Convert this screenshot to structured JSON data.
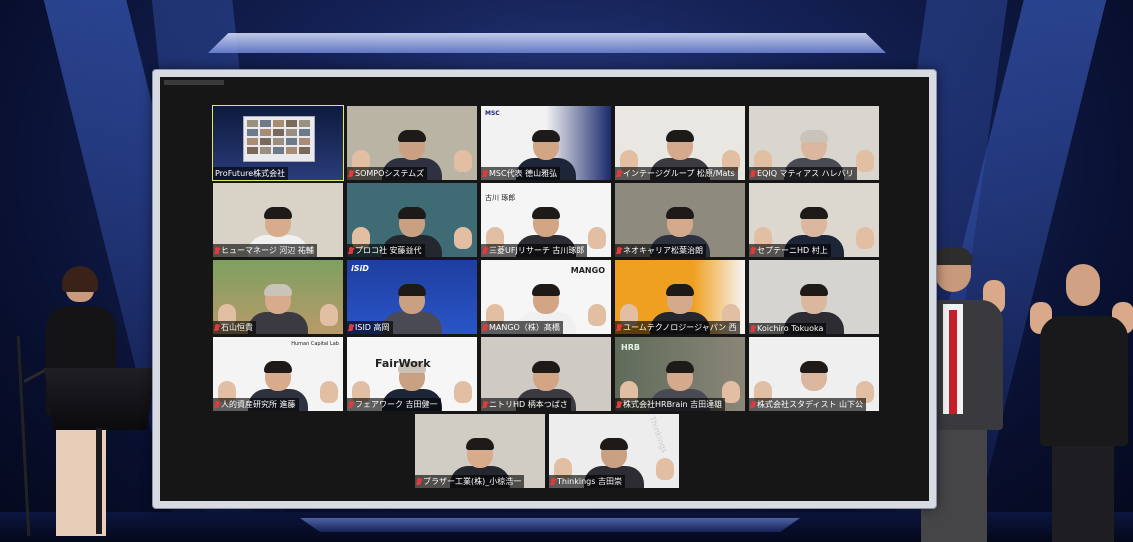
{
  "window": {
    "title": ""
  },
  "colors": {
    "active_speaker_border": "#e4ea52",
    "mic_muted": "#e03a3a",
    "stage_blue": "#152257"
  },
  "tiles": [
    {
      "name": "ProFuture株式会社",
      "muted": false,
      "active": true
    },
    {
      "name": "SOMPOシステムズ",
      "muted": true,
      "active": false
    },
    {
      "name": "MSC代表 德山雅弘",
      "muted": true,
      "active": false
    },
    {
      "name": "インテージグループ 松原/Mats",
      "muted": true,
      "active": false
    },
    {
      "name": "EQIQ マティアス ハレバリ",
      "muted": true,
      "active": false
    },
    {
      "name": "ヒューマネージ 河辺 祐輔",
      "muted": true,
      "active": false
    },
    {
      "name": "プロコ社 安藤益代",
      "muted": true,
      "active": false
    },
    {
      "name": "三菱UFJリサーチ 古川琢郎",
      "muted": true,
      "active": false
    },
    {
      "name": "ネオキャリア松葉治朗",
      "muted": true,
      "active": false
    },
    {
      "name": "セプテーニHD 村上",
      "muted": true,
      "active": false
    },
    {
      "name": "石山恒貴",
      "muted": true,
      "active": false
    },
    {
      "name": "ISID 高岡",
      "muted": true,
      "active": false
    },
    {
      "name": "MANGO（株）髙橋",
      "muted": true,
      "active": false
    },
    {
      "name": "ユームテクノロジージャパン 西",
      "muted": true,
      "active": false
    },
    {
      "name": "Koichiro Tokuoka",
      "muted": true,
      "active": false
    },
    {
      "name": "人的資産研究所 進藤",
      "muted": true,
      "active": false
    },
    {
      "name": "フェアワーク 吉田健一",
      "muted": true,
      "active": false
    },
    {
      "name": "ニトリHD 柄本つばさ",
      "muted": true,
      "active": false
    },
    {
      "name": "株式会社HRBrain 吉田達雄",
      "muted": true,
      "active": false
    },
    {
      "name": "株式会社スタディスト 山下公",
      "muted": true,
      "active": false
    },
    {
      "name": "ブラザー工業(株)_小椋浩一",
      "muted": true,
      "active": false
    },
    {
      "name": "Thinkings 吉田崇",
      "muted": true,
      "active": false
    }
  ],
  "tile_overlays": {
    "msc_logo": "MSC",
    "mitsubishi_name": "古川 琢郎",
    "mango_logo": "MANGO",
    "isid_logo": "iSiD",
    "fairwork_logo": "FairWork",
    "hrbrain_logo": "HRB",
    "humancapital_logo": "Human Capital Lab",
    "thinkings_logo": "Thinkings"
  }
}
